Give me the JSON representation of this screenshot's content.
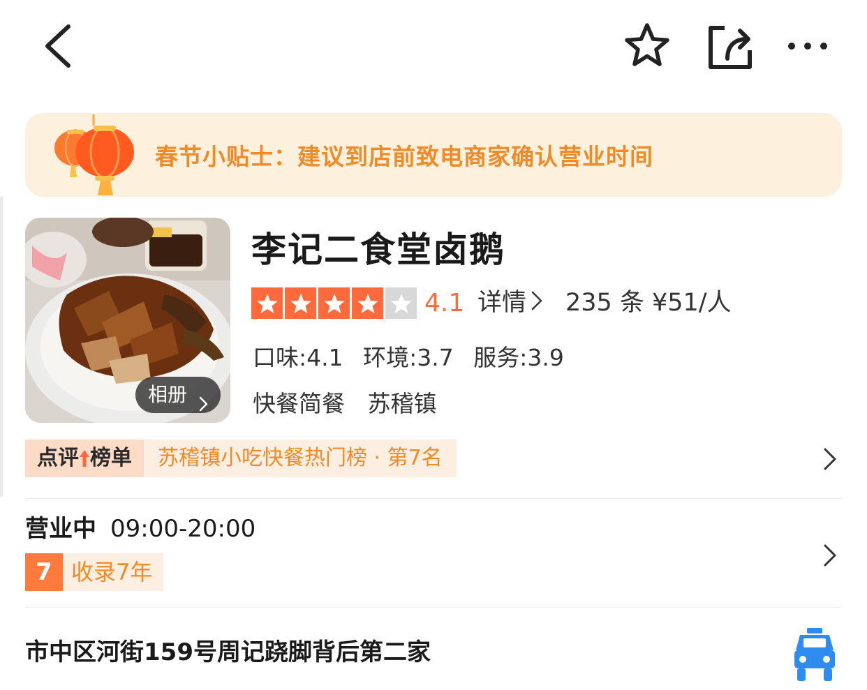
{
  "nav": {
    "back_icon": "chevron-left-icon",
    "favorite_icon": "star-outline-icon",
    "share_icon": "share-icon",
    "more_icon": "more-dots-icon"
  },
  "notice": {
    "icon": "lantern-icon",
    "text": "春节小贴士：建议到店前致电商家确认营业时间",
    "color": "#ef8a27",
    "background": "#fdf0dd"
  },
  "shop": {
    "name": "李记二食堂卤鹅",
    "album_label": "相册",
    "stars": 4,
    "stars_total": 5,
    "rating": "4.1",
    "detail_label": "详情",
    "review_count": "235 条",
    "avg_price": "¥51/人",
    "scores": [
      {
        "text": "口味:4.1"
      },
      {
        "text": "环境:3.7"
      },
      {
        "text": "服务:3.9"
      }
    ],
    "category": "快餐简餐",
    "area": "苏稽镇",
    "accent_color": "#ff6a3d"
  },
  "ranking": {
    "tag_left": "点评",
    "tag_right": "榜单",
    "text": "苏稽镇小吃快餐热门榜 · 第7名"
  },
  "hours": {
    "status": "营业中",
    "time": "09:00-20:00",
    "years_number": "7",
    "years_text": "收录7年"
  },
  "address": {
    "text": "市中区河街159号周记跷脚背后第二家",
    "taxi_icon": "taxi-icon"
  }
}
